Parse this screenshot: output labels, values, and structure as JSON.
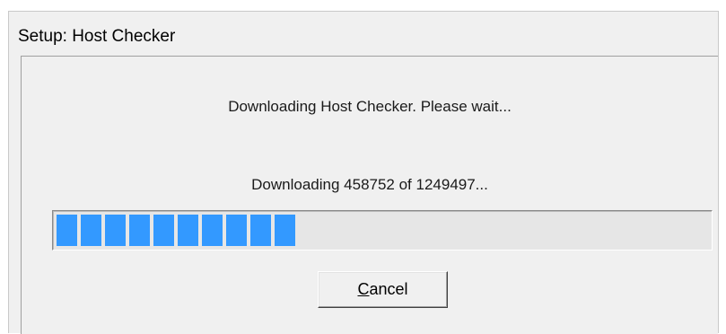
{
  "window": {
    "title": "Setup: Host Checker"
  },
  "dialog": {
    "message": "Downloading Host Checker. Please wait...",
    "status": "Downloading 458752 of 1249497...",
    "progress": {
      "downloaded": 458752,
      "total": 1249497,
      "fill_color": "#3399ff"
    },
    "cancel_button": {
      "mnemonic": "C",
      "rest": "ancel"
    }
  }
}
